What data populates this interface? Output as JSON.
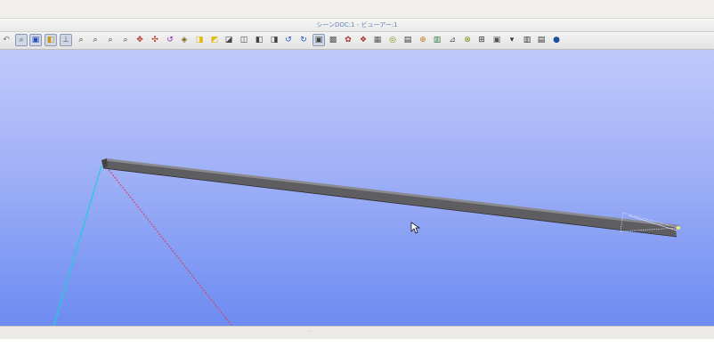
{
  "window": {
    "title": "シーンDOC:1 - ビューアー:1"
  },
  "toolbar": {
    "buttons": [
      {
        "name": "undo-view-icon",
        "glyph": "↶",
        "color": "#777"
      },
      {
        "name": "dynamic-zoom-icon",
        "glyph": "⌕",
        "color": "#444",
        "active": true
      },
      {
        "name": "select-icon",
        "glyph": "▣",
        "color": "#2a4fb8",
        "active": true
      },
      {
        "name": "fit-all-icon",
        "glyph": "◧",
        "color": "#c8961b",
        "active": true
      },
      {
        "name": "axis-icon",
        "glyph": "⊥",
        "color": "#555",
        "active": true
      },
      {
        "name": "zoom-icon",
        "glyph": "⌕",
        "color": "#333"
      },
      {
        "name": "zoom-window-icon",
        "glyph": "⌕",
        "color": "#333"
      },
      {
        "name": "zoom-in-icon",
        "glyph": "⌕",
        "color": "#333"
      },
      {
        "name": "zoom-out-icon",
        "glyph": "⌕",
        "color": "#333"
      },
      {
        "name": "pan-icon",
        "glyph": "✥",
        "color": "#b32a1e"
      },
      {
        "name": "global-pan-icon",
        "glyph": "✣",
        "color": "#b32a1e"
      },
      {
        "name": "rotate-icon",
        "glyph": "↺",
        "color": "#7a2f9c"
      },
      {
        "name": "reset-view-icon",
        "glyph": "◈",
        "color": "#7a6a1a"
      },
      {
        "name": "front-view-icon",
        "glyph": "◨",
        "color": "#e0b800"
      },
      {
        "name": "back-view-icon",
        "glyph": "◩",
        "color": "#e0b800"
      },
      {
        "name": "top-view-icon",
        "glyph": "◪",
        "color": "#444"
      },
      {
        "name": "bottom-view-icon",
        "glyph": "◫",
        "color": "#444"
      },
      {
        "name": "left-view-icon",
        "glyph": "◧",
        "color": "#444"
      },
      {
        "name": "right-view-icon",
        "glyph": "◨",
        "color": "#444"
      },
      {
        "name": "rotate-left-icon",
        "glyph": "↺",
        "color": "#2255c8"
      },
      {
        "name": "rotate-right-icon",
        "glyph": "↻",
        "color": "#2255c8"
      },
      {
        "name": "wireframe-icon",
        "glyph": "▣",
        "color": "#444",
        "active": true
      },
      {
        "name": "shading-icon",
        "glyph": "▩",
        "color": "#555"
      },
      {
        "name": "material-icon",
        "glyph": "✿",
        "color": "#a33"
      },
      {
        "name": "texture-icon",
        "glyph": "❖",
        "color": "#a33"
      },
      {
        "name": "clipping-icon",
        "glyph": "▦",
        "color": "#555"
      },
      {
        "name": "transparency-icon",
        "glyph": "◎",
        "color": "#7a8c14"
      },
      {
        "name": "graduated-trihedron-icon",
        "glyph": "▤",
        "color": "#333"
      },
      {
        "name": "trihedron-icon",
        "glyph": "⊕",
        "color": "#c87a14"
      },
      {
        "name": "dump-view-icon",
        "glyph": "▥",
        "color": "#2e7a3c"
      },
      {
        "name": "export-icon",
        "glyph": "⊿",
        "color": "#555"
      },
      {
        "name": "sync-icon",
        "glyph": "⊗",
        "color": "#7a8c14"
      },
      {
        "name": "sketch-icon",
        "glyph": "⊞",
        "color": "#333"
      },
      {
        "name": "measure-icon",
        "glyph": "▣",
        "color": "#555"
      },
      {
        "name": "dropdown-arrow-icon",
        "glyph": "▾",
        "color": "#333"
      },
      {
        "name": "cylinder-icon",
        "glyph": "▥",
        "color": "#333"
      },
      {
        "name": "database-icon",
        "glyph": "▤",
        "color": "#333"
      },
      {
        "name": "sphere-icon",
        "glyph": "●",
        "color": "#1c4fa0"
      }
    ]
  },
  "viewport": {
    "background_top": "#c0c9fb",
    "background_bottom": "#6d8cf2",
    "beam_color": "#5e5e60",
    "axis_x_color": "#e4345a",
    "axis_y_color": "#1ccfd6"
  }
}
